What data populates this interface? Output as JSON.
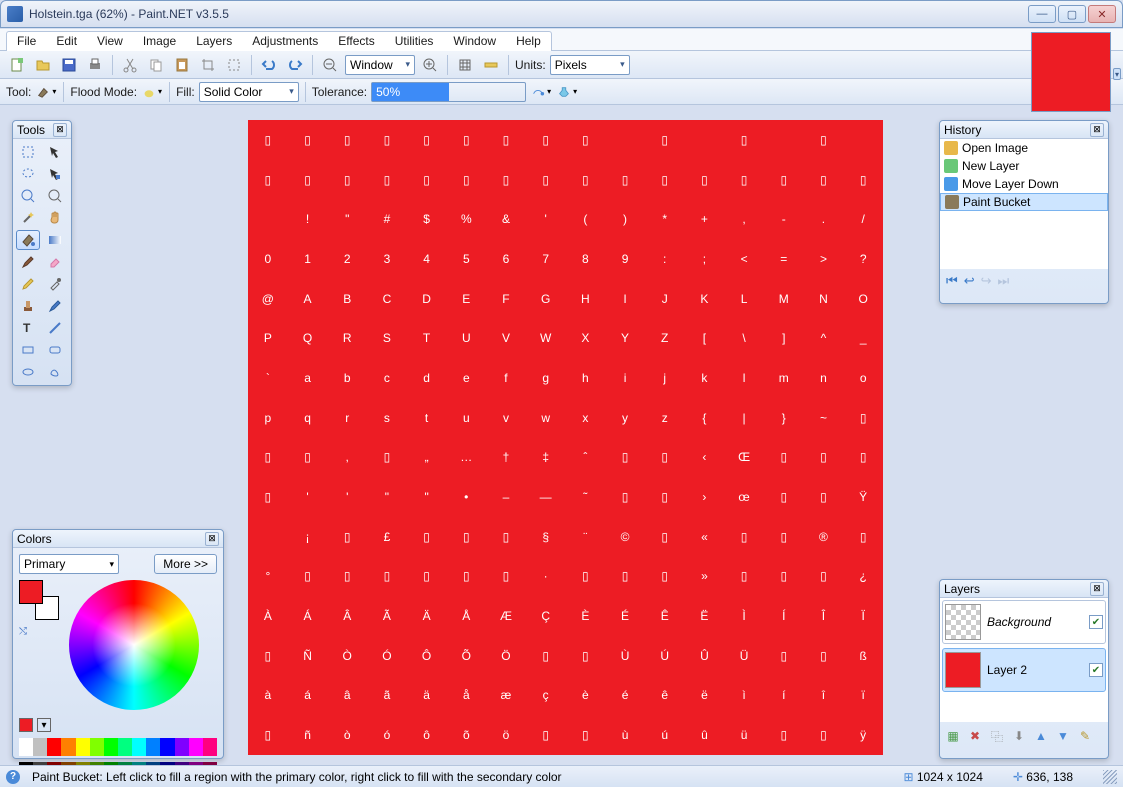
{
  "window": {
    "title": "Holstein.tga (62%) - Paint.NET v3.5.5",
    "min": "—",
    "max": "▢",
    "close": "✕"
  },
  "menu": [
    "File",
    "Edit",
    "View",
    "Image",
    "Layers",
    "Adjustments",
    "Effects",
    "Utilities",
    "Window",
    "Help"
  ],
  "toolbar1": {
    "view_combo": "Window",
    "units_label": "Units:",
    "units_value": "Pixels"
  },
  "toolbar2": {
    "tool_label": "Tool:",
    "flood_label": "Flood Mode:",
    "fill_label": "Fill:",
    "fill_value": "Solid Color",
    "tolerance_label": "Tolerance:",
    "tolerance_value": "50%"
  },
  "tools_panel": {
    "title": "Tools"
  },
  "colors_panel": {
    "title": "Colors",
    "mode": "Primary",
    "more": "More >>",
    "primary_color": "#ed1c24",
    "secondary_color": "#ffffff"
  },
  "history": {
    "title": "History",
    "items": [
      {
        "label": "Open Image",
        "icon": "#e8b84a"
      },
      {
        "label": "New Layer",
        "icon": "#6ac878"
      },
      {
        "label": "Move Layer Down",
        "icon": "#4a9ae8"
      },
      {
        "label": "Paint Bucket",
        "icon": "#8a7a5a"
      }
    ],
    "selected": 3
  },
  "layers": {
    "title": "Layers",
    "items": [
      {
        "name": "Background",
        "italic": true,
        "checked": true,
        "thumb": "checker"
      },
      {
        "name": "Layer 2",
        "italic": false,
        "checked": true,
        "thumb": "#ed1c24"
      }
    ],
    "selected": 1
  },
  "status": {
    "text": "Paint Bucket: Left click to fill a region with the primary color, right click to fill with the secondary color",
    "dims": "1024 x 1024",
    "pos": "636, 138"
  },
  "glyphs": [
    "▯",
    "▯",
    "▯",
    "▯",
    "▯",
    "▯",
    "▯",
    "▯",
    "▯",
    "",
    "▯",
    "",
    "▯",
    "",
    "▯",
    "",
    "▯",
    "▯",
    "▯",
    "▯",
    "▯",
    "▯",
    "▯",
    "▯",
    "▯",
    "▯",
    "▯",
    "▯",
    "▯",
    "▯",
    "▯",
    "▯",
    "",
    "!",
    "\"",
    "#",
    "$",
    "%",
    "&",
    "'",
    "(",
    ")",
    "*",
    "+",
    ",",
    "-",
    ".",
    "/",
    "0",
    "1",
    "2",
    "3",
    "4",
    "5",
    "6",
    "7",
    "8",
    "9",
    ":",
    ";",
    "<",
    "=",
    ">",
    "?",
    "@",
    "A",
    "B",
    "C",
    "D",
    "E",
    "F",
    "G",
    "H",
    "I",
    "J",
    "K",
    "L",
    "M",
    "N",
    "O",
    "P",
    "Q",
    "R",
    "S",
    "T",
    "U",
    "V",
    "W",
    "X",
    "Y",
    "Z",
    "[",
    "\\",
    "]",
    "^",
    "_",
    "`",
    "a",
    "b",
    "c",
    "d",
    "e",
    "f",
    "g",
    "h",
    "i",
    "j",
    "k",
    "l",
    "m",
    "n",
    "o",
    "p",
    "q",
    "r",
    "s",
    "t",
    "u",
    "v",
    "w",
    "x",
    "y",
    "z",
    "{",
    "|",
    "}",
    "~",
    "▯",
    "▯",
    "▯",
    ",",
    "▯",
    "„",
    "…",
    "†",
    "‡",
    "ˆ",
    "▯",
    "▯",
    "‹",
    "Œ",
    "▯",
    "▯",
    "▯",
    "▯",
    "'",
    "'",
    "\"",
    "\"",
    "•",
    "–",
    "—",
    "˜",
    "▯",
    "▯",
    "›",
    "œ",
    "▯",
    "▯",
    "Ÿ",
    "",
    "¡",
    "▯",
    "£",
    "▯",
    "▯",
    "▯",
    "§",
    "¨",
    "©",
    "▯",
    "«",
    "▯",
    "▯",
    "®",
    "▯",
    "°",
    "▯",
    "▯",
    "▯",
    "▯",
    "▯",
    "▯",
    "·",
    "▯",
    "▯",
    "▯",
    "»",
    "▯",
    "▯",
    "▯",
    "¿",
    "À",
    "Á",
    "Â",
    "Ã",
    "Ä",
    "Å",
    "Æ",
    "Ç",
    "È",
    "É",
    "Ê",
    "Ë",
    "Ì",
    "Í",
    "Î",
    "Ï",
    "▯",
    "Ñ",
    "Ò",
    "Ó",
    "Ô",
    "Õ",
    "Ö",
    "▯",
    "▯",
    "Ù",
    "Ú",
    "Û",
    "Ü",
    "▯",
    "▯",
    "ß",
    "à",
    "á",
    "â",
    "ã",
    "ä",
    "å",
    "æ",
    "ç",
    "è",
    "é",
    "ê",
    "ë",
    "ì",
    "í",
    "î",
    "ï",
    "▯",
    "ñ",
    "ò",
    "ó",
    "ô",
    "õ",
    "ö",
    "▯",
    "▯",
    "ù",
    "ú",
    "û",
    "ü",
    "▯",
    "▯",
    "ÿ"
  ]
}
